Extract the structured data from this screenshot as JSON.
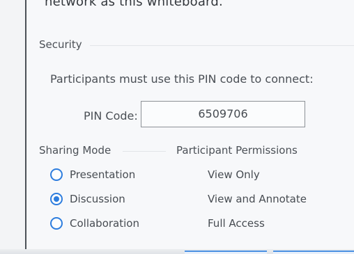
{
  "header": {
    "text": "network as this whiteboard."
  },
  "security": {
    "title": "Security",
    "instruction": "Participants must use this PIN code to connect:",
    "pin_label": "PIN Code:",
    "pin_value": "6509706"
  },
  "sharing": {
    "title": "Sharing Mode",
    "permissions_title": "Participant Permissions",
    "options": [
      {
        "label": "Presentation",
        "permission": "View Only",
        "selected": false
      },
      {
        "label": "Discussion",
        "permission": "View and Annotate",
        "selected": true
      },
      {
        "label": "Collaboration",
        "permission": "Full Access",
        "selected": false
      }
    ]
  },
  "colors": {
    "accent": "#2d7dde",
    "text": "#474c52",
    "muted_line": "#e2e5e8"
  },
  "icons": {
    "radio": "radio-button-icon"
  }
}
